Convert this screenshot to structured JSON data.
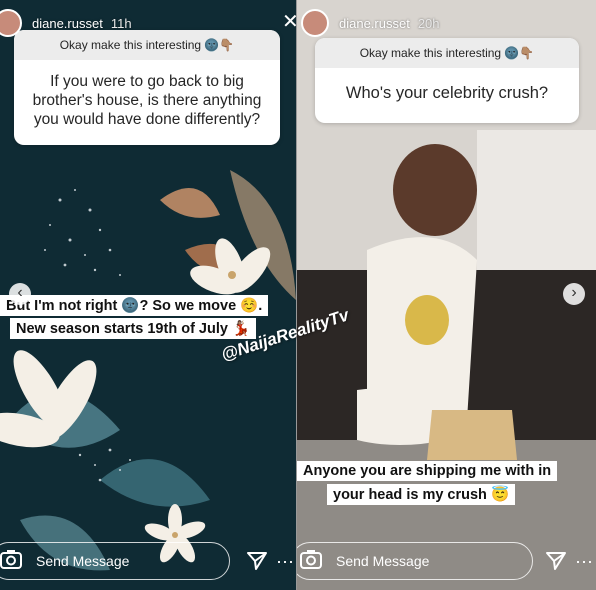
{
  "left_story": {
    "username": "diane.russet",
    "time": "11h",
    "question_header": "Okay make this interesting 🌚👇🏽",
    "question": "If you were to go back to big brother's house, is there anything you would have done differently?",
    "caption_line1": "But I'm not right 🌚? So we move ☺️.",
    "caption_line2": "New season starts 19th of July 💃🏽",
    "send_placeholder": "Send Message"
  },
  "right_story": {
    "username": "diane.russet",
    "time": "20h",
    "question_header": "Okay make this interesting 🌚👇🏽",
    "question": "Who's your celebrity crush?",
    "caption_line1": "Anyone you are shipping me with in",
    "caption_line2": "your head is my crush 😇",
    "send_placeholder": "Send Message"
  },
  "watermark": "@NaijaRealityTv",
  "icons": [
    "close-icon",
    "camera-icon",
    "send-icon",
    "more-icon",
    "prev-arrow-icon",
    "next-arrow-icon"
  ],
  "colors": {
    "left_bg": "#0e2a33",
    "card_header": "#ececec",
    "white": "#ffffff"
  }
}
